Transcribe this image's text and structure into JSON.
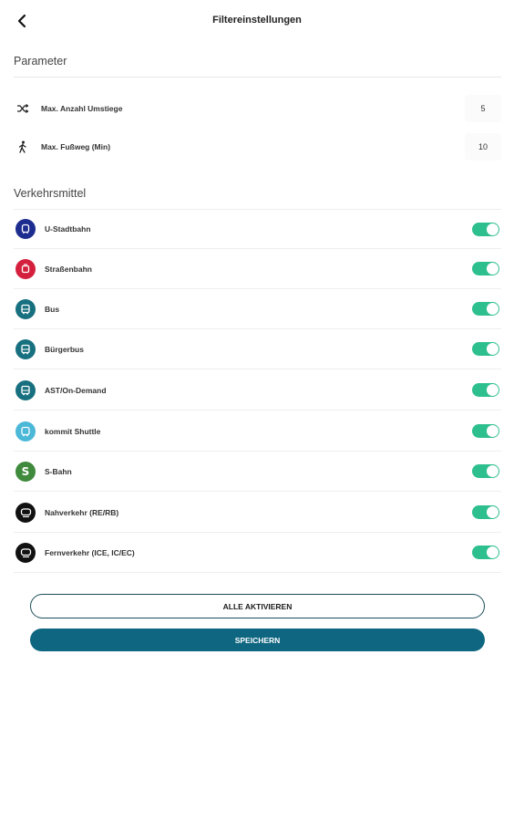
{
  "header": {
    "title": "Filtereinstellungen",
    "back_icon": "chevron-left-icon"
  },
  "parameters": {
    "title": "Parameter",
    "items": [
      {
        "label": "Max. Anzahl Umstiege",
        "value": "5",
        "icon": "shuffle-icon"
      },
      {
        "label": "Max. Fußweg (Min)",
        "value": "10",
        "icon": "walk-icon"
      }
    ]
  },
  "transport": {
    "title": "Verkehrsmittel",
    "items": [
      {
        "label": "U-Stadtbahn",
        "icon": "subway-icon",
        "color": "#1c2c8f",
        "enabled": true
      },
      {
        "label": "Straßenbahn",
        "icon": "tram-icon",
        "color": "#d4203c",
        "enabled": true
      },
      {
        "label": "Bus",
        "icon": "bus-icon",
        "color": "#17707f",
        "enabled": true
      },
      {
        "label": "Bürgerbus",
        "icon": "bus-icon",
        "color": "#17707f",
        "enabled": true
      },
      {
        "label": "AST/On-Demand",
        "icon": "bus-icon",
        "color": "#17707f",
        "enabled": true
      },
      {
        "label": "kommit Shuttle",
        "icon": "shuttle-icon",
        "color": "#4bb8d8",
        "enabled": true
      },
      {
        "label": "S-Bahn",
        "icon": "s-bahn-icon",
        "color": "#3f8a3c",
        "enabled": true
      },
      {
        "label": "Nahverkehr (RE/RB)",
        "icon": "train-icon",
        "color": "#111111",
        "enabled": true
      },
      {
        "label": "Fernverkehr (ICE, IC/EC)",
        "icon": "train-icon",
        "color": "#111111",
        "enabled": true
      }
    ]
  },
  "buttons": {
    "activate_all": "ALLE AKTIVIEREN",
    "save": "SPEICHERN"
  },
  "colors": {
    "toggle_on": "#2ebf8f",
    "primary": "#0e6680"
  }
}
